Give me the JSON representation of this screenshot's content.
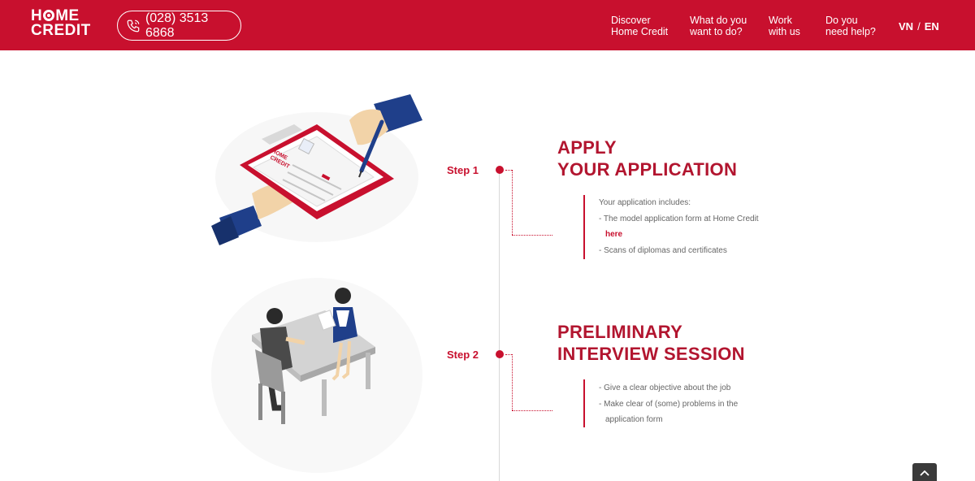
{
  "header": {
    "logo_line1": "HOME",
    "logo_line2": "CREDIT",
    "phone": "(028) 3513 6868",
    "nav": [
      {
        "line1": "Discover",
        "line2": "Home Credit"
      },
      {
        "line1": "What do you",
        "line2": "want to do?"
      },
      {
        "line1": "Work",
        "line2": "with us"
      },
      {
        "line1": "Do you",
        "line2": "need help?"
      }
    ],
    "lang_vn": "VN",
    "lang_sep": "/",
    "lang_en": "EN"
  },
  "steps": [
    {
      "label": "Step 1",
      "title_line1": "APPLY",
      "title_line2": "YOUR APPLICATION",
      "intro": "Your application includes:",
      "items": [
        "- The model application form at Home Credit",
        "- Scans of diplomas and certificates"
      ],
      "link": "here"
    },
    {
      "label": "Step 2",
      "title_line1": "PRELIMINARY",
      "title_line2": "INTERVIEW SESSION",
      "items": [
        "- Give a clear objective about the job",
        "- Make clear of (some) problems in the",
        "application form"
      ]
    }
  ],
  "illustration_text": {
    "form_brand_1": "HOME",
    "form_brand_2": "CREDIT"
  },
  "colors": {
    "brand_red": "#c8102e",
    "heading_red": "#b2152f",
    "text_gray": "#666666",
    "scroll_btn": "#3a3a3a"
  },
  "icons": {
    "phone": "phone-icon",
    "scroll_top": "chevron-up-icon"
  }
}
